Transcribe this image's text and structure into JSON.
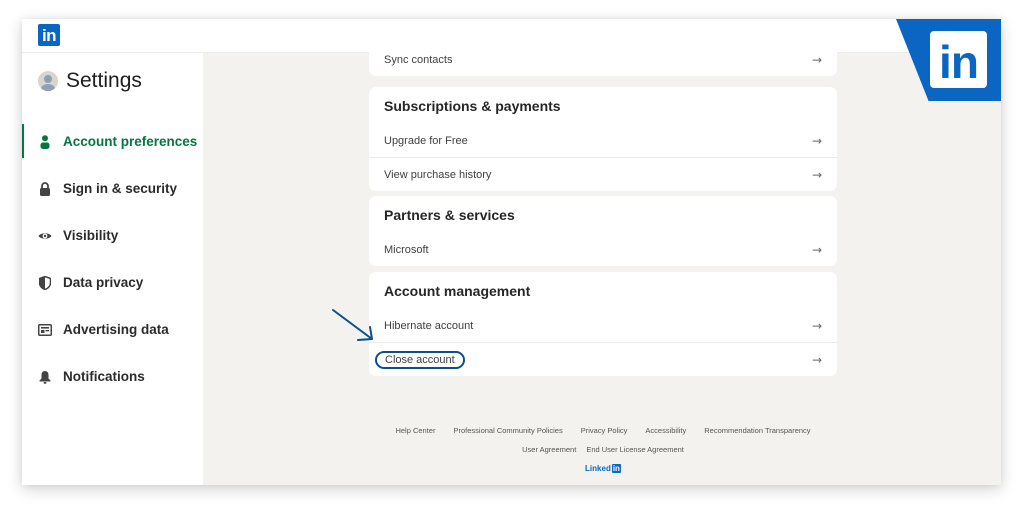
{
  "app": {
    "logo": "in"
  },
  "sidebar": {
    "title": "Settings",
    "items": [
      {
        "label": "Account preferences",
        "icon": "person-icon",
        "active": true
      },
      {
        "label": "Sign in & security",
        "icon": "lock-icon",
        "active": false
      },
      {
        "label": "Visibility",
        "icon": "eye-icon",
        "active": false
      },
      {
        "label": "Data privacy",
        "icon": "shield-icon",
        "active": false
      },
      {
        "label": "Advertising data",
        "icon": "ad-card-icon",
        "active": false
      },
      {
        "label": "Notifications",
        "icon": "bell-icon",
        "active": false
      }
    ]
  },
  "main": {
    "sync": {
      "rows": [
        {
          "label": "Sync contacts"
        }
      ]
    },
    "subscriptions": {
      "title": "Subscriptions & payments",
      "rows": [
        {
          "label": "Upgrade for Free"
        },
        {
          "label": "View purchase history"
        }
      ]
    },
    "partners": {
      "title": "Partners & services",
      "rows": [
        {
          "label": "Microsoft"
        }
      ]
    },
    "account_management": {
      "title": "Account management",
      "rows": [
        {
          "label": "Hibernate account"
        },
        {
          "label": "Close account"
        }
      ]
    },
    "arrow_glyph": "→"
  },
  "footer": {
    "links_row1": [
      "Help Center",
      "Professional Community Policies",
      "Privacy Policy",
      "Accessibility",
      "Recommendation Transparency"
    ],
    "links_row2": [
      "User Agreement",
      "End User License Agreement"
    ],
    "brand_text": "Linked",
    "brand_in": "in"
  },
  "badge": {
    "logo": "in"
  },
  "colors": {
    "brand": "#0a66c2",
    "active": "#057642",
    "annotation": "#0d4f8b"
  }
}
